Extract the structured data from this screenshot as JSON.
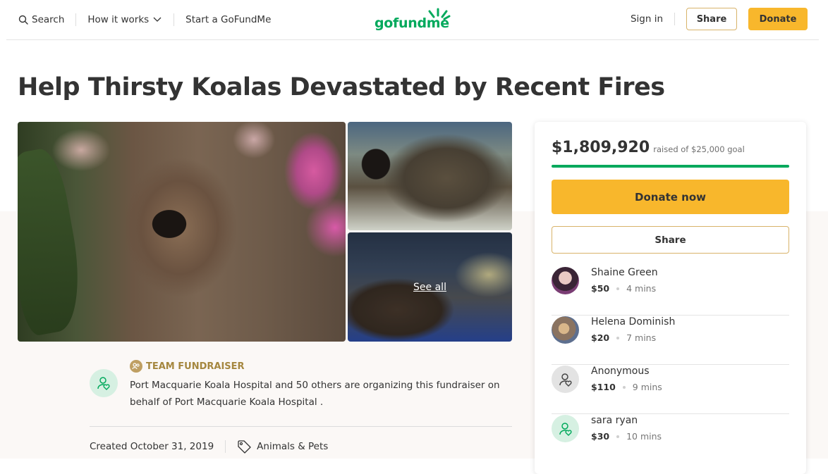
{
  "header": {
    "search_label": "Search",
    "how_it_works_label": "How it works",
    "start_label": "Start a GoFundMe",
    "logo_text": "gofundme",
    "signin_label": "Sign in",
    "share_label": "Share",
    "donate_label": "Donate"
  },
  "campaign": {
    "title": "Help Thirsty Koalas Devastated by Recent Fires",
    "see_all_label": "See all",
    "team_label": "TEAM FUNDRAISER",
    "organizer_text": "Port Macquarie Koala Hospital and 50 others are organizing this fundraiser on behalf of Port Macquarie Koala Hospital .",
    "created_label": "Created October 31, 2019",
    "category_label": "Animals & Pets"
  },
  "sidebar": {
    "raised_amount": "$1,809,920",
    "raised_goal_text": "raised of $25,000 goal",
    "progress_fraction": 1.0,
    "donate_now_label": "Donate now",
    "share_label": "Share",
    "donors": [
      {
        "name": "Shaine Green",
        "amount": "$50",
        "time": "4 mins",
        "avatar": "photo"
      },
      {
        "name": "Helena Dominish",
        "amount": "$20",
        "time": "7 mins",
        "avatar": "photo"
      },
      {
        "name": "Anonymous",
        "amount": "$110",
        "time": "9 mins",
        "avatar": "anonymous-icon"
      },
      {
        "name": "sara ryan",
        "amount": "$30",
        "time": "10 mins",
        "avatar": "user-heart-icon"
      }
    ]
  },
  "colors": {
    "brand_green": "#02a95c",
    "donate_yellow": "#f8b72c",
    "team_gold": "#a5873f"
  }
}
